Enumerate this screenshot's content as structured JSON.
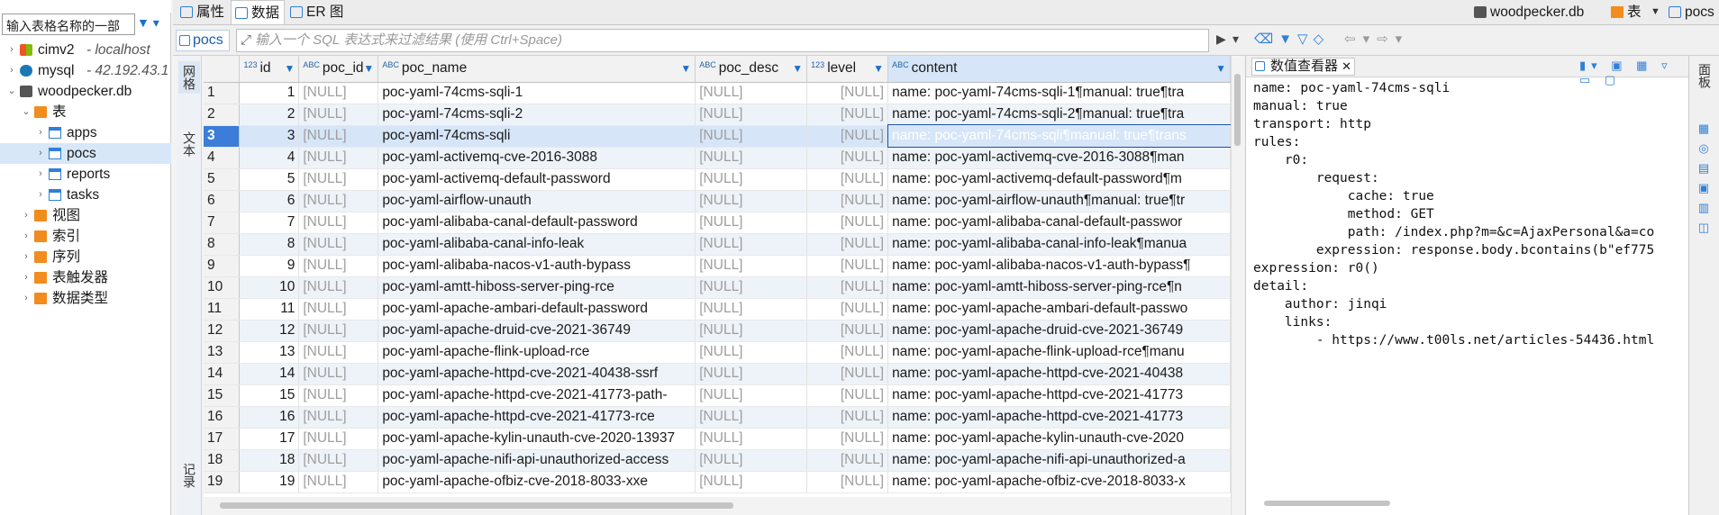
{
  "navigator": {
    "search_placeholder": "输入表格名称的一部",
    "tree": [
      {
        "label": "cimv2",
        "sub": " - localhost",
        "icon": "windows-icon",
        "depth": 0,
        "expanded": false
      },
      {
        "label": "mysql",
        "sub": " - 42.192.43.1",
        "icon": "mysql-icon",
        "depth": 0,
        "expanded": false
      },
      {
        "label": "woodpecker.db",
        "sub": "",
        "icon": "database-icon",
        "depth": 0,
        "expanded": true
      },
      {
        "label": "表",
        "sub": "",
        "icon": "folder-icon",
        "depth": 1,
        "expanded": true
      },
      {
        "label": "apps",
        "sub": "",
        "icon": "table-icon",
        "depth": 2,
        "expanded": false
      },
      {
        "label": "pocs",
        "sub": "",
        "icon": "table-icon",
        "depth": 2,
        "expanded": false,
        "selected": true
      },
      {
        "label": "reports",
        "sub": "",
        "icon": "table-icon",
        "depth": 2,
        "expanded": false
      },
      {
        "label": "tasks",
        "sub": "",
        "icon": "table-icon",
        "depth": 2,
        "expanded": false
      },
      {
        "label": "视图",
        "sub": "",
        "icon": "folder-icon",
        "depth": 1,
        "expanded": false
      },
      {
        "label": "索引",
        "sub": "",
        "icon": "folder-icon",
        "depth": 1,
        "expanded": false
      },
      {
        "label": "序列",
        "sub": "",
        "icon": "folder-icon",
        "depth": 1,
        "expanded": false
      },
      {
        "label": "表触发器",
        "sub": "",
        "icon": "folder-icon",
        "depth": 1,
        "expanded": false
      },
      {
        "label": "数据类型",
        "sub": "",
        "icon": "folder-icon",
        "depth": 1,
        "expanded": false
      }
    ]
  },
  "tabs": {
    "properties": "属性",
    "data": "数据",
    "er": "ER 图",
    "db_tab": "woodpecker.db",
    "table_tab": "表",
    "pocs_tab": "pocs"
  },
  "filter": {
    "table_chip": "pocs",
    "placeholder": "输入一个 SQL 表达式来过滤结果 (使用 Ctrl+Space)"
  },
  "side_tabs": {
    "grid": "网格",
    "text": "文本",
    "record": "记录"
  },
  "columns": [
    {
      "name": "id",
      "type": "123"
    },
    {
      "name": "poc_id",
      "type": "ABC"
    },
    {
      "name": "poc_name",
      "type": "ABC"
    },
    {
      "name": "poc_desc",
      "type": "ABC"
    },
    {
      "name": "level",
      "type": "123"
    },
    {
      "name": "content",
      "type": "ABC"
    }
  ],
  "rows": [
    {
      "n": "1",
      "id": "1",
      "poc_id": "[NULL]",
      "poc_name": "poc-yaml-74cms-sqli-1",
      "poc_desc": "[NULL]",
      "level": "[NULL]",
      "content": "name: poc-yaml-74cms-sqli-1¶manual: true¶tra"
    },
    {
      "n": "2",
      "id": "2",
      "poc_id": "[NULL]",
      "poc_name": "poc-yaml-74cms-sqli-2",
      "poc_desc": "[NULL]",
      "level": "[NULL]",
      "content": "name: poc-yaml-74cms-sqli-2¶manual: true¶tra"
    },
    {
      "n": "3",
      "id": "3",
      "poc_id": "[NULL]",
      "poc_name": "poc-yaml-74cms-sqli",
      "poc_desc": "[NULL]",
      "level": "[NULL]",
      "content": "name: poc-yaml-74cms-sqli¶manual: true¶trans"
    },
    {
      "n": "4",
      "id": "4",
      "poc_id": "[NULL]",
      "poc_name": "poc-yaml-activemq-cve-2016-3088",
      "poc_desc": "[NULL]",
      "level": "[NULL]",
      "content": "name: poc-yaml-activemq-cve-2016-3088¶man"
    },
    {
      "n": "5",
      "id": "5",
      "poc_id": "[NULL]",
      "poc_name": "poc-yaml-activemq-default-password",
      "poc_desc": "[NULL]",
      "level": "[NULL]",
      "content": "name: poc-yaml-activemq-default-password¶m"
    },
    {
      "n": "6",
      "id": "6",
      "poc_id": "[NULL]",
      "poc_name": "poc-yaml-airflow-unauth",
      "poc_desc": "[NULL]",
      "level": "[NULL]",
      "content": "name: poc-yaml-airflow-unauth¶manual: true¶tr"
    },
    {
      "n": "7",
      "id": "7",
      "poc_id": "[NULL]",
      "poc_name": "poc-yaml-alibaba-canal-default-password",
      "poc_desc": "[NULL]",
      "level": "[NULL]",
      "content": "name: poc-yaml-alibaba-canal-default-passwor"
    },
    {
      "n": "8",
      "id": "8",
      "poc_id": "[NULL]",
      "poc_name": "poc-yaml-alibaba-canal-info-leak",
      "poc_desc": "[NULL]",
      "level": "[NULL]",
      "content": "name: poc-yaml-alibaba-canal-info-leak¶manua"
    },
    {
      "n": "9",
      "id": "9",
      "poc_id": "[NULL]",
      "poc_name": "poc-yaml-alibaba-nacos-v1-auth-bypass",
      "poc_desc": "[NULL]",
      "level": "[NULL]",
      "content": "name: poc-yaml-alibaba-nacos-v1-auth-bypass¶"
    },
    {
      "n": "10",
      "id": "10",
      "poc_id": "[NULL]",
      "poc_name": "poc-yaml-amtt-hiboss-server-ping-rce",
      "poc_desc": "[NULL]",
      "level": "[NULL]",
      "content": "name: poc-yaml-amtt-hiboss-server-ping-rce¶n"
    },
    {
      "n": "11",
      "id": "11",
      "poc_id": "[NULL]",
      "poc_name": "poc-yaml-apache-ambari-default-password",
      "poc_desc": "[NULL]",
      "level": "[NULL]",
      "content": "name: poc-yaml-apache-ambari-default-passwo"
    },
    {
      "n": "12",
      "id": "12",
      "poc_id": "[NULL]",
      "poc_name": "poc-yaml-apache-druid-cve-2021-36749",
      "poc_desc": "[NULL]",
      "level": "[NULL]",
      "content": "name: poc-yaml-apache-druid-cve-2021-36749"
    },
    {
      "n": "13",
      "id": "13",
      "poc_id": "[NULL]",
      "poc_name": "poc-yaml-apache-flink-upload-rce",
      "poc_desc": "[NULL]",
      "level": "[NULL]",
      "content": "name: poc-yaml-apache-flink-upload-rce¶manu"
    },
    {
      "n": "14",
      "id": "14",
      "poc_id": "[NULL]",
      "poc_name": "poc-yaml-apache-httpd-cve-2021-40438-ssrf",
      "poc_desc": "[NULL]",
      "level": "[NULL]",
      "content": "name: poc-yaml-apache-httpd-cve-2021-40438"
    },
    {
      "n": "15",
      "id": "15",
      "poc_id": "[NULL]",
      "poc_name": "poc-yaml-apache-httpd-cve-2021-41773-path-",
      "poc_desc": "[NULL]",
      "level": "[NULL]",
      "content": "name: poc-yaml-apache-httpd-cve-2021-41773"
    },
    {
      "n": "16",
      "id": "16",
      "poc_id": "[NULL]",
      "poc_name": "poc-yaml-apache-httpd-cve-2021-41773-rce",
      "poc_desc": "[NULL]",
      "level": "[NULL]",
      "content": "name: poc-yaml-apache-httpd-cve-2021-41773"
    },
    {
      "n": "17",
      "id": "17",
      "poc_id": "[NULL]",
      "poc_name": "poc-yaml-apache-kylin-unauth-cve-2020-13937",
      "poc_desc": "[NULL]",
      "level": "[NULL]",
      "content": "name: poc-yaml-apache-kylin-unauth-cve-2020"
    },
    {
      "n": "18",
      "id": "18",
      "poc_id": "[NULL]",
      "poc_name": "poc-yaml-apache-nifi-api-unauthorized-access",
      "poc_desc": "[NULL]",
      "level": "[NULL]",
      "content": "name: poc-yaml-apache-nifi-api-unauthorized-a"
    },
    {
      "n": "19",
      "id": "19",
      "poc_id": "[NULL]",
      "poc_name": "poc-yaml-apache-ofbiz-cve-2018-8033-xxe",
      "poc_desc": "[NULL]",
      "level": "[NULL]",
      "content": "name: poc-yaml-apache-ofbiz-cve-2018-8033-x"
    }
  ],
  "selected_row": 3,
  "viewer": {
    "title": "数值查看器",
    "lines": [
      "name: poc-yaml-74cms-sqli",
      "manual: true",
      "transport: http",
      "rules:",
      "    r0:",
      "        request:",
      "            cache: true",
      "            method: GET",
      "            path: /index.php?m=&c=AjaxPersonal&a=co",
      "        expression: response.body.bcontains(b\"ef775",
      "expression: r0()",
      "detail:",
      "    author: jinqi",
      "    links:",
      "        - https://www.t00ls.net/articles-54436.html"
    ]
  },
  "right_rail_label": "面板"
}
